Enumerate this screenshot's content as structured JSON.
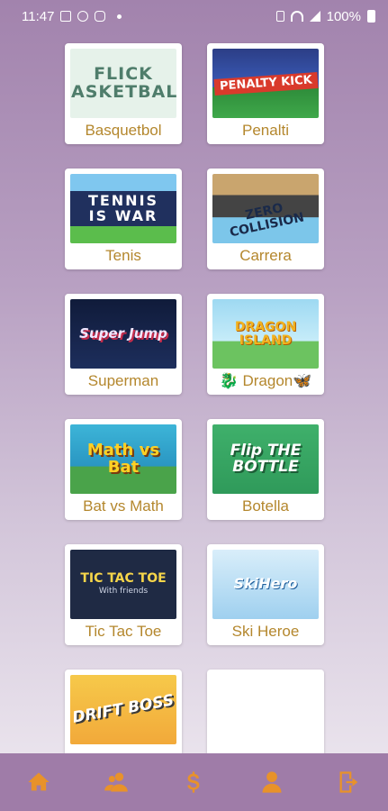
{
  "status_bar": {
    "time": "11:47",
    "battery": "100%"
  },
  "games": [
    {
      "label": "Basquetbol",
      "thumb_text": "FLICK BASKETBALL",
      "thumb_sub": ""
    },
    {
      "label": "Penalti",
      "thumb_text": "PENALTY KICK",
      "thumb_sub": ""
    },
    {
      "label": "Tenis",
      "thumb_text": "TENNIS IS WAR",
      "thumb_sub": ""
    },
    {
      "label": "Carrera",
      "thumb_text": "ZERO COLLISION",
      "thumb_sub": ""
    },
    {
      "label": "Superman",
      "thumb_text": "Super Jump",
      "thumb_sub": ""
    },
    {
      "label": "🐉 Dragon🦋",
      "thumb_text": "DRAGON ISLAND",
      "thumb_sub": ""
    },
    {
      "label": "Bat vs Math",
      "thumb_text": "Math vs Bat",
      "thumb_sub": ""
    },
    {
      "label": "Botella",
      "thumb_text": "Flip THE BOTTLE",
      "thumb_sub": ""
    },
    {
      "label": "Tic Tac Toe",
      "thumb_text": "TIC TAC TOE",
      "thumb_sub": "With friends"
    },
    {
      "label": "Ski Heroe",
      "thumb_text": "SkiHero",
      "thumb_sub": ""
    },
    {
      "label": "",
      "thumb_text": "DRIFT BOSS",
      "thumb_sub": ""
    },
    {
      "label": "",
      "thumb_text": "",
      "thumb_sub": ""
    }
  ],
  "bottom_nav": [
    {
      "icon": "home-icon"
    },
    {
      "icon": "users-icon"
    },
    {
      "icon": "dollar-icon"
    },
    {
      "icon": "user-icon"
    },
    {
      "icon": "logout-icon"
    }
  ],
  "colors": {
    "label": "#b4872d",
    "nav_bg": "#9f7ca8",
    "nav_icon": "#e8922a"
  }
}
